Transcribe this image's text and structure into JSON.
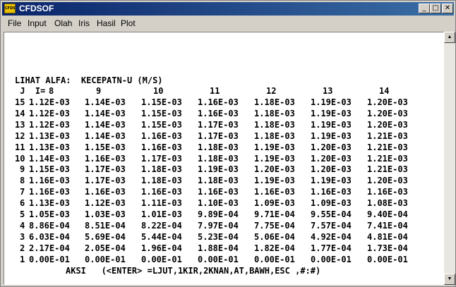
{
  "window": {
    "title": "CFDSOF",
    "icon_text": "CFDSOF",
    "minimize": "_",
    "maximize": "□",
    "close": "✕"
  },
  "menu": [
    "File",
    "Input",
    "Olah",
    "Iris",
    "Hasil",
    "Plot"
  ],
  "console": {
    "heading": "LIHAT ALFA:  KECEPATN-U (M/S)",
    "col_header_label": " J  I=",
    "columns": [
      "8",
      "9",
      "10",
      "11",
      "12",
      "13",
      "14"
    ],
    "rows": [
      {
        "j": "15",
        "v": [
          "1.12E-03",
          "1.14E-03",
          "1.15E-03",
          "1.16E-03",
          "1.18E-03",
          "1.19E-03",
          "1.20E-03"
        ]
      },
      {
        "j": "14",
        "v": [
          "1.12E-03",
          "1.14E-03",
          "1.15E-03",
          "1.16E-03",
          "1.18E-03",
          "1.19E-03",
          "1.20E-03"
        ]
      },
      {
        "j": "13",
        "v": [
          "1.12E-03",
          "1.14E-03",
          "1.15E-03",
          "1.17E-03",
          "1.18E-03",
          "1.19E-03",
          "1.20E-03"
        ]
      },
      {
        "j": "12",
        "v": [
          "1.13E-03",
          "1.14E-03",
          "1.16E-03",
          "1.17E-03",
          "1.18E-03",
          "1.19E-03",
          "1.21E-03"
        ]
      },
      {
        "j": "11",
        "v": [
          "1.13E-03",
          "1.15E-03",
          "1.16E-03",
          "1.18E-03",
          "1.19E-03",
          "1.20E-03",
          "1.21E-03"
        ]
      },
      {
        "j": "10",
        "v": [
          "1.14E-03",
          "1.16E-03",
          "1.17E-03",
          "1.18E-03",
          "1.19E-03",
          "1.20E-03",
          "1.21E-03"
        ]
      },
      {
        "j": "9",
        "v": [
          "1.15E-03",
          "1.17E-03",
          "1.18E-03",
          "1.19E-03",
          "1.20E-03",
          "1.20E-03",
          "1.21E-03"
        ]
      },
      {
        "j": "8",
        "v": [
          "1.16E-03",
          "1.17E-03",
          "1.18E-03",
          "1.18E-03",
          "1.19E-03",
          "1.19E-03",
          "1.20E-03"
        ]
      },
      {
        "j": "7",
        "v": [
          "1.16E-03",
          "1.16E-03",
          "1.16E-03",
          "1.16E-03",
          "1.16E-03",
          "1.16E-03",
          "1.16E-03"
        ]
      },
      {
        "j": "6",
        "v": [
          "1.13E-03",
          "1.12E-03",
          "1.11E-03",
          "1.10E-03",
          "1.09E-03",
          "1.09E-03",
          "1.08E-03"
        ]
      },
      {
        "j": "5",
        "v": [
          "1.05E-03",
          "1.03E-03",
          "1.01E-03",
          "9.89E-04",
          "9.71E-04",
          "9.55E-04",
          "9.40E-04"
        ]
      },
      {
        "j": "4",
        "v": [
          "8.86E-04",
          "8.51E-04",
          "8.22E-04",
          "7.97E-04",
          "7.75E-04",
          "7.57E-04",
          "7.41E-04"
        ]
      },
      {
        "j": "3",
        "v": [
          "6.03E-04",
          "5.69E-04",
          "5.44E-04",
          "5.23E-04",
          "5.06E-04",
          "4.92E-04",
          "4.81E-04"
        ]
      },
      {
        "j": "2",
        "v": [
          "2.17E-04",
          "2.05E-04",
          "1.96E-04",
          "1.88E-04",
          "1.82E-04",
          "1.77E-04",
          "1.73E-04"
        ]
      },
      {
        "j": "1",
        "v": [
          "0.00E-01",
          "0.00E-01",
          "0.00E-01",
          "0.00E-01",
          "0.00E-01",
          "0.00E-01",
          "0.00E-01"
        ]
      }
    ],
    "prompt": "AKSI   (<ENTER> =LJUT,1KIR,2KNAN,AT,BAWH,ESC ,#:#)"
  },
  "scrollbar": {
    "up": "▲",
    "down": "▼"
  }
}
